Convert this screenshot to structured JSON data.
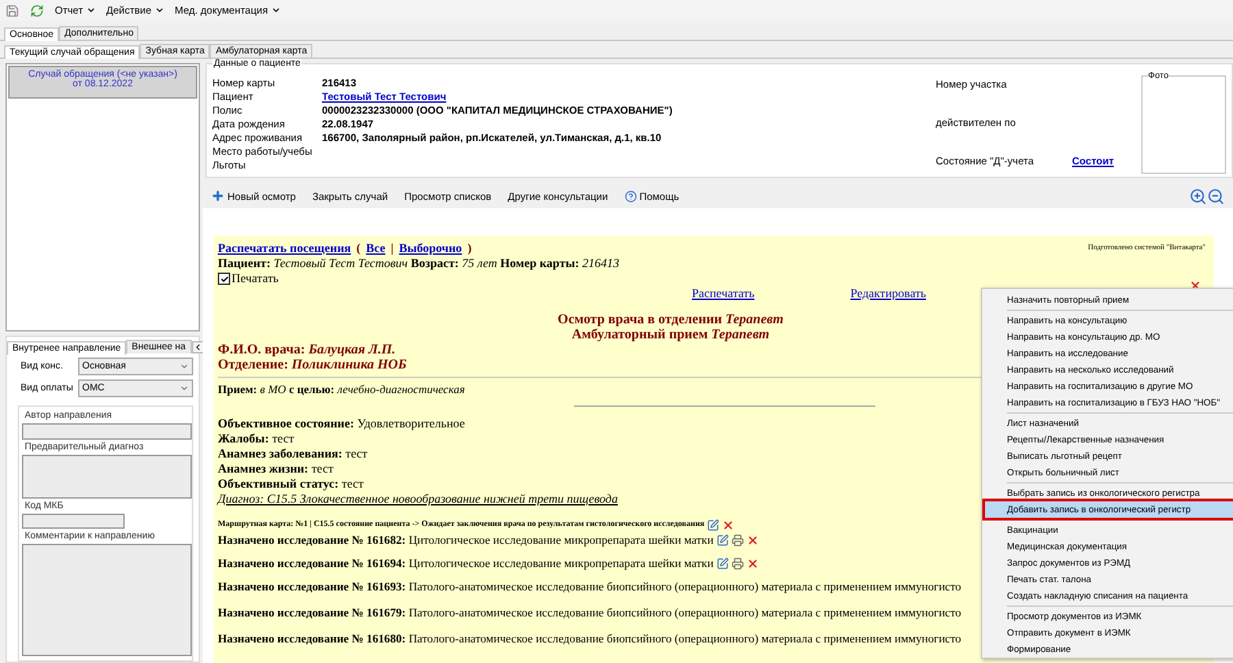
{
  "toolbar": {
    "menus": [
      {
        "label": "Отчет"
      },
      {
        "label": "Действие"
      },
      {
        "label": "Мед. документация"
      }
    ]
  },
  "main_tabs": [
    {
      "label": "Основное",
      "selected": true
    },
    {
      "label": "Дополнительно",
      "selected": false
    }
  ],
  "sub_tabs": [
    {
      "label": "Текущий случай обращения",
      "selected": true
    },
    {
      "label": "Зубная карта",
      "selected": false
    },
    {
      "label": "Амбулаторная карта",
      "selected": false
    }
  ],
  "case_list": [
    {
      "title": "Случай обращения (<не указан>)",
      "date": "от 08.12.2022",
      "selected": true
    }
  ],
  "referral": {
    "tabs": [
      {
        "label": "Внутренее направление",
        "selected": true
      },
      {
        "label": "Внешнее на",
        "selected": false
      }
    ],
    "selects": [
      {
        "label": "Вид конс.",
        "value": "Основная"
      },
      {
        "label": "Вид оплаты",
        "value": "ОМС"
      }
    ],
    "fields": [
      {
        "label": "Автор направления",
        "kind": "line"
      },
      {
        "label": "Предварительный диагноз",
        "kind": "area"
      },
      {
        "label": "Код МКБ",
        "kind": "short"
      },
      {
        "label": "Комментарии к направлению",
        "kind": "tall"
      }
    ]
  },
  "patient": {
    "title": "Данные о пациенте",
    "rows": [
      {
        "label": "Номер карты",
        "value": "216413",
        "kind": "text"
      },
      {
        "label": "Пациент",
        "value": "Тестовый Тест Тестович",
        "kind": "link"
      },
      {
        "label": "Полис",
        "value": "0000023232330000 (ООО \"КАПИТАЛ МЕДИЦИНСКОЕ СТРАХОВАНИЕ\")",
        "kind": "text"
      },
      {
        "label": "Дата рождения",
        "value": "22.08.1947",
        "kind": "text"
      },
      {
        "label": "Адрес проживания",
        "value": "166700, Заполярный район, рп.Искателей, ул.Тиманская, д.1, кв.10",
        "kind": "text"
      },
      {
        "label": "Место работы/учебы"
      },
      {
        "label": "Льготы"
      }
    ],
    "side": [
      {
        "label": "Номер участка"
      },
      {
        "label": "действителен по"
      },
      {
        "label": "Состояние \"Д\"-учета",
        "value": "Состоит"
      }
    ],
    "photo_label": "Фото"
  },
  "actions": [
    {
      "label": "Новый осмотр",
      "kind": "add"
    },
    {
      "label": "Закрыть случай",
      "kind": "plain"
    },
    {
      "label": "Просмотр списков",
      "kind": "plain"
    },
    {
      "label": "Другие консультации",
      "kind": "plain"
    },
    {
      "label": "Помощь",
      "kind": "help"
    }
  ],
  "document": {
    "print_link": "Распечатать посещения",
    "open": "(",
    "options": [
      "Все",
      "Выборочно"
    ],
    "divider": "|",
    "close": ")",
    "prepared_by": "Подготовлено системой \"Витакарта\"",
    "patient_line": "**Пациент:** *Тестовый Тест Тестович* **Возраст:** *75 лет* **Номер карты:** *216413*",
    "print_checkbox": {
      "label": "Печатать",
      "checked": true
    },
    "links": [
      "Распечатать",
      "Редактировать"
    ],
    "title_lines": [
      "Осмотр врача в отделении *Терапевт*",
      "Амбулаторный прием *Терапевт*"
    ],
    "doctor_lines": [
      "Ф.И.О. врача: *Балуцкая Л.П.*",
      "Отделение: *Поликлиника НОБ*"
    ],
    "reception": "**Прием:** *в МО* **с целью:** *лечебно-диагностическая*",
    "findings": [
      "**Объективное состояние:** Удовлетворительное",
      "**Жалобы:** тест",
      "**Анамнез заболевания:** тест",
      "**Анамнез жизни:** тест",
      "**Объективный статус:** тест"
    ],
    "diagnosis": "Диагноз: C15.5 Злокачественное новообразование нижней трети пищевода",
    "route": "Маршрутная карта: №1 | C15.5 состояние пациента -> Ожидает заключения врача по результатам гистологического исследования",
    "studies": [
      {
        "text": "**Назначено исследование № 161682:** Цитологическое исследование микропрепарата шейки матки",
        "kind": "editable"
      },
      {
        "text": "**Назначено исследование № 161694:** Цитологическое исследование микропрепарата шейки матки",
        "kind": "editable"
      },
      {
        "text": "**Назначено исследование № 161693:** Патолого-анатомическое исследование биопсийного (операционного) материала с применением иммуногисто",
        "kind": "plain"
      },
      {
        "text": "**Назначено исследование № 161679:** Патолого-анатомическое исследование биопсийного (операционного) материала с применением иммуногисто",
        "kind": "plain"
      },
      {
        "text": "**Назначено исследование № 161680:** Патолого-анатомическое исследование биопсийного (операционного) материала с применением иммуногисто",
        "kind": "plain"
      }
    ]
  },
  "context_menu": {
    "groups": [
      [
        {
          "label": "Назначить повторный прием",
          "selected": false
        }
      ],
      [
        {
          "label": "Направить на консультацию",
          "selected": false
        },
        {
          "label": "Направить на консультацию др. МО",
          "selected": false
        },
        {
          "label": "Направить на исследование",
          "selected": false
        },
        {
          "label": "Направить на несколько исследований",
          "selected": false
        },
        {
          "label": "Направить на госпитализацию в другие МО",
          "selected": false
        },
        {
          "label": "Направить на госпитализацию в ГБУЗ НАО \"НОБ\"",
          "selected": false
        }
      ],
      [
        {
          "label": "Лист назначений",
          "selected": false
        },
        {
          "label": "Рецепты/Лекарственные назначения",
          "selected": false
        },
        {
          "label": "Выписать льготный рецепт",
          "selected": false
        },
        {
          "label": "Открыть больничный лист",
          "selected": false
        }
      ],
      [
        {
          "label": "Выбрать запись из онкологического регистра",
          "selected": false
        },
        {
          "label": "Добавить запись в онкологический регистр",
          "selected": true
        }
      ],
      [
        {
          "label": "Вакцинации",
          "selected": false
        },
        {
          "label": "Медицинская документация",
          "selected": false
        },
        {
          "label": "Запрос документов из РЭМД",
          "selected": false
        },
        {
          "label": "Печать стат. талона",
          "selected": false
        },
        {
          "label": "Создать накладную списания на пациента",
          "selected": false
        }
      ],
      [
        {
          "label": "Просмотр документов из ИЭМК",
          "selected": false
        },
        {
          "label": "Отправить документ в ИЭМК",
          "selected": false
        },
        {
          "label": "Формирование",
          "selected": false
        }
      ]
    ]
  }
}
